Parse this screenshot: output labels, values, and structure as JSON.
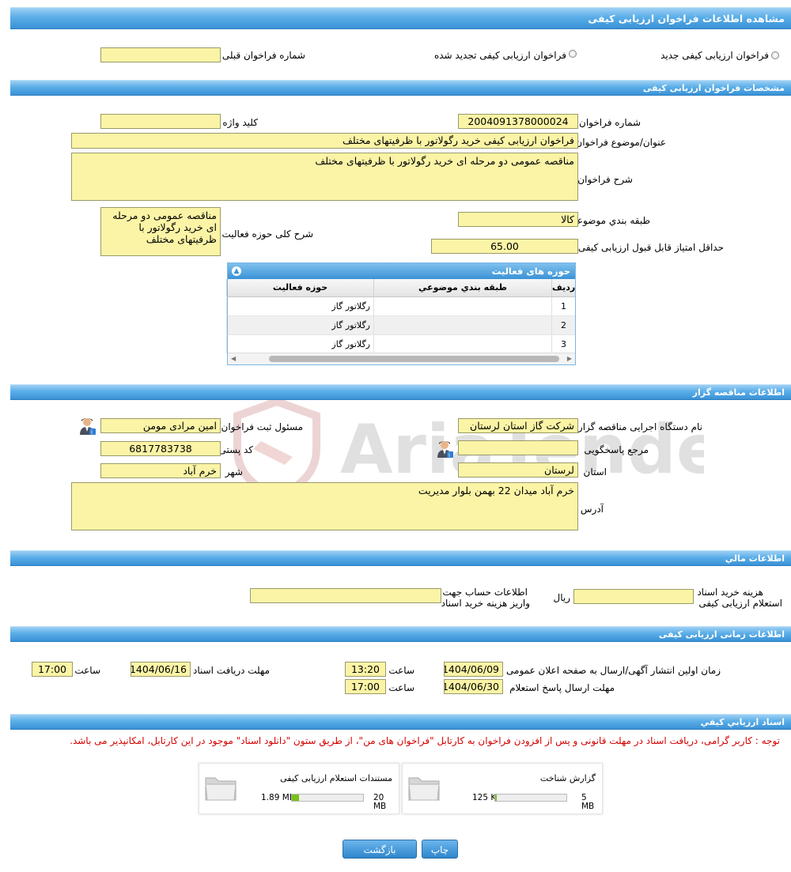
{
  "header": {
    "title": "مشاهده اطلاعات فراخوان ارزیابی کیفی"
  },
  "type_row": {
    "new_label": "فراخوان ارزیابی کیفی جدید",
    "renewed_label": "فراخوان ارزیابی کیفی تجدید شده",
    "previous_number_label": "شماره فراخوان قبلی",
    "previous_number_value": ""
  },
  "specs": {
    "section_title": "مشخصات فراخوان ارزیابی کیفی",
    "number_label": "شماره فراخوان",
    "number_value": "2004091378000024",
    "keyword_label": "کلید واژه",
    "keyword_value": "",
    "subject_label": "عنوان/موضوع فراخوان",
    "subject_value": "فراخوان ارزیابی کیفی خرید رگولاتور با ظرفیتهای مختلف",
    "desc_label": "شرح فراخوان",
    "desc_value": "مناقصه عمومی دو مرحله ای خرید رگولاتور با ظرفیتهای مختلف",
    "category_label": "طبقه بندي موضوعي",
    "category_value": "کالا",
    "activity_desc_label": "شرح کلی حوزه فعالیت",
    "activity_desc_value": "مناقصه عمومی دو مرحله ای خرید رگولاتور با ظرفیتهای مختلف",
    "min_score_label": "حداقل امتیاز قابل قبول ارزیابی کیفی",
    "min_score_value": "65.00"
  },
  "activity_grid": {
    "title": "حوزه های فعالیت",
    "columns": [
      "رديف",
      "طبقه بندي موضوعي",
      "حوزه فعالیت"
    ],
    "rows": [
      {
        "num": "1",
        "category": "",
        "field": "رگلاتور گاز"
      },
      {
        "num": "2",
        "category": "",
        "field": "رگلاتور گاز"
      },
      {
        "num": "3",
        "category": "",
        "field": "رگلاتور گاز"
      }
    ]
  },
  "organizer": {
    "section_title": "اطلاعات مناقصه گزار",
    "org_label": "نام دستگاه اجرایی مناقصه گزار",
    "org_value": "شرکت گاز استان لرستان",
    "registrar_label": "مسئول ثبت فراخوان",
    "registrar_value": "امین مرادی مومن",
    "reference_label": "مرجع پاسخگویی",
    "reference_value": "",
    "postal_label": "کد پستی",
    "postal_value": "6817783738",
    "province_label": "استان",
    "province_value": "لرستان",
    "city_label": "شهر",
    "city_value": "خرم آباد",
    "address_label": "آدرس",
    "address_value": "خرم آباد میدان 22 بهمن بلوار مدیریت"
  },
  "financial": {
    "section_title": "اطلاعات مالي",
    "fee_label_1": "هزینه خرید اسناد",
    "fee_label_2": "استعلام ارزیابی کیفی",
    "fee_value": "",
    "currency": "ریال",
    "account_label_1": "اطلاعات حساب جهت",
    "account_label_2": "واریز هزینه خرید اسناد",
    "account_value": ""
  },
  "timing": {
    "section_title": "اطلاعات زمانی ارزیابی کیفی",
    "publish_label": "زمان اولین انتشار آگهی/ارسال به صفحه اعلان عمومی",
    "publish_date": "1404/06/09",
    "publish_time": "13:20",
    "receive_label": "مهلت دریافت اسناد",
    "receive_date": "1404/06/16",
    "receive_time": "17:00",
    "reply_label": "مهلت ارسال پاسخ استعلام",
    "reply_date": "1404/06/30",
    "reply_time": "17:00",
    "time_label": "ساعت"
  },
  "documents": {
    "section_title": "اسناد ارزيابي كيفي",
    "note": "توجه : کاربر گرامی، دریافت اسناد در مهلت قانونی و پس از افزودن فراخوان به کارتابل \"فراخوان های من\"، از طریق ستون \"دانلود اسناد\" موجود در این کارتابل، امکانپذیر می باشد.",
    "files": [
      {
        "title": "گزارش شناخت",
        "size": "125 KB",
        "max": "5 MB",
        "progress": 0.025
      },
      {
        "title": "مستندات استعلام ارزیابی کیفی",
        "size": "1.89 MB",
        "max": "20 MB",
        "progress": 0.095
      }
    ]
  },
  "buttons": {
    "print": "چاپ",
    "back": "بازگشت"
  },
  "watermark": {
    "text": "AriaTender.neT"
  },
  "colors": {
    "field_bg": "#fbf4a6",
    "header_blue": "#3a92d6",
    "note_red": "#d40000"
  }
}
